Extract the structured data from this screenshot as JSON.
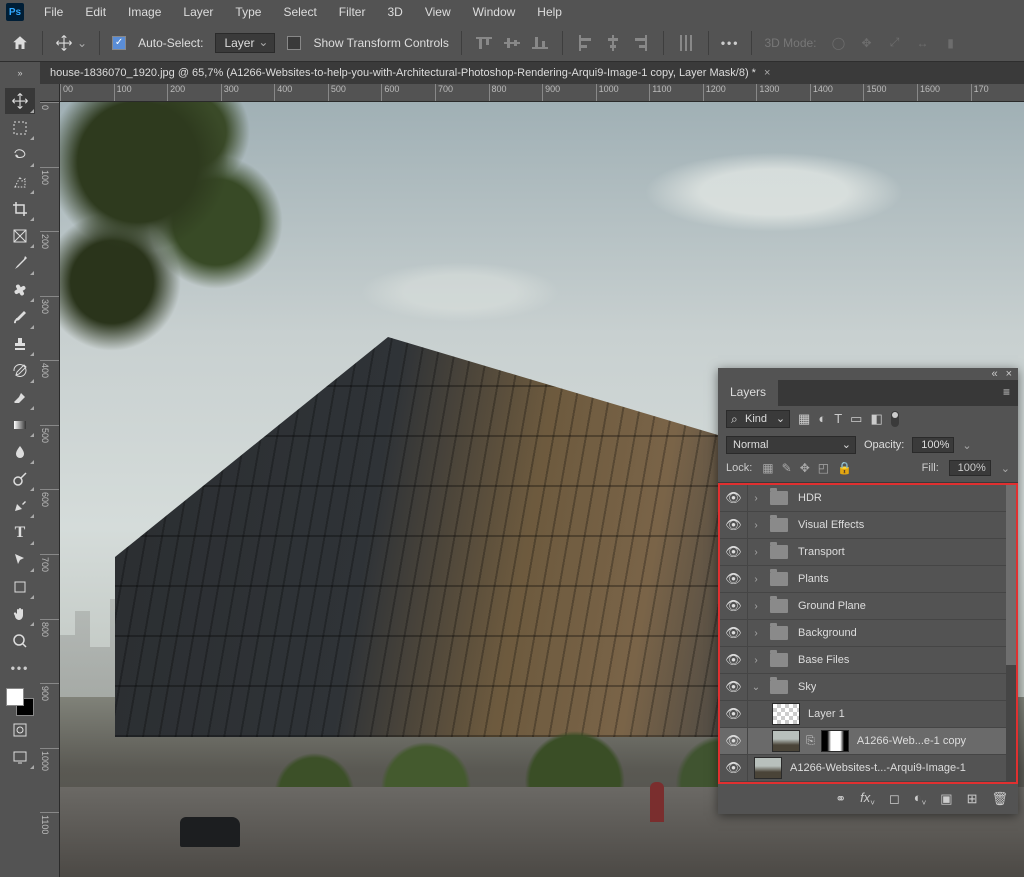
{
  "menu": [
    "File",
    "Edit",
    "Image",
    "Layer",
    "Type",
    "Select",
    "Filter",
    "3D",
    "View",
    "Window",
    "Help"
  ],
  "options": {
    "auto_select_label": "Auto-Select:",
    "auto_select_target": "Layer",
    "show_transform_label": "Show Transform Controls",
    "mode3d_label": "3D Mode:"
  },
  "doc": {
    "title": "house-1836070_1920.jpg @ 65,7% (A1266-Websites-to-help-you-with-Architectural-Photoshop-Rendering-Arqui9-Image-1 copy, Layer Mask/8) *"
  },
  "ruler_h": [
    "00",
    "100",
    "200",
    "300",
    "400",
    "500",
    "600",
    "700",
    "800",
    "900",
    "1000",
    "1100",
    "1200",
    "1300",
    "1400",
    "1500",
    "1600",
    "170"
  ],
  "ruler_v": [
    "0",
    "100",
    "200",
    "300",
    "400",
    "500",
    "600",
    "700",
    "800",
    "900",
    "1000",
    "1100"
  ],
  "layers_panel": {
    "title": "Layers",
    "kind_label": "Kind",
    "blend_mode": "Normal",
    "opacity_label": "Opacity:",
    "opacity_value": "100%",
    "lock_label": "Lock:",
    "fill_label": "Fill:",
    "fill_value": "100%",
    "groups": [
      {
        "name": "HDR"
      },
      {
        "name": "Visual Effects"
      },
      {
        "name": "Transport"
      },
      {
        "name": "Plants"
      },
      {
        "name": "Ground Plane"
      },
      {
        "name": "Background"
      },
      {
        "name": "Base Files"
      }
    ],
    "open_group": {
      "name": "Sky"
    },
    "sky_children": [
      {
        "name": "Layer 1",
        "type": "checker"
      },
      {
        "name": "A1266-Web...e-1 copy",
        "type": "masked",
        "selected": true
      }
    ],
    "bottom_layer": {
      "name": "A1266-Websites-t...-Arqui9-Image-1"
    }
  }
}
